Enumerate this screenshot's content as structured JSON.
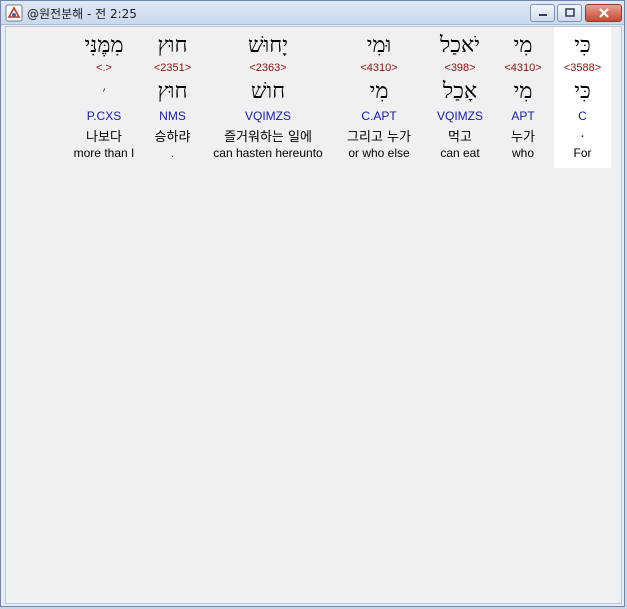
{
  "window": {
    "title": "@원전분해 - 전 2:25"
  },
  "columns": [
    {
      "hebrew": "כִּי",
      "strong": "<3588>",
      "hebrew_lex": "כִּי",
      "parse": "C",
      "korean": ".",
      "english": "For"
    },
    {
      "hebrew": "מִי",
      "strong": "<4310>",
      "hebrew_lex": "מִי",
      "parse": "APT",
      "korean": "누가",
      "english": "who"
    },
    {
      "hebrew": "יֹאכַל",
      "strong": "<398>",
      "hebrew_lex": "אָכַל",
      "parse": "VQIMZS",
      "korean": "먹고",
      "english": "can eat"
    },
    {
      "hebrew": "וּמִי",
      "strong": "<4310>",
      "hebrew_lex": "מִי",
      "parse": "C.APT",
      "korean": "그리고 누가",
      "english": "or who else"
    },
    {
      "hebrew": "יָחוּשׁ",
      "strong": "<2363>",
      "hebrew_lex": "חושׁ",
      "parse": "VQIMZS",
      "korean": "즐거워하는 일에",
      "english": "can hasten hereunto"
    },
    {
      "hebrew": "חוּץ",
      "strong": "<2351>",
      "hebrew_lex": "חוּץ",
      "parse": "NMS",
      "korean": "승하랴",
      "english": "."
    },
    {
      "hebrew": "מִמֶּנִּי",
      "strong": "<.>",
      "hebrew_lex": "׳",
      "parse": "P.CXS",
      "korean": "나보다",
      "english": "more than I"
    }
  ]
}
